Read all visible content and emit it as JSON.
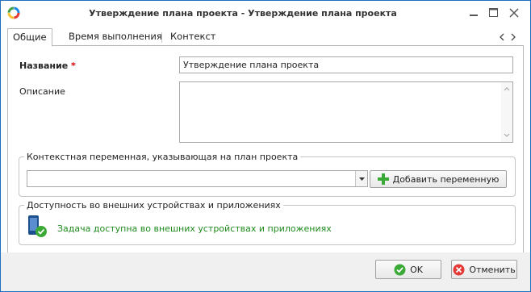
{
  "window": {
    "title": "Утверждение плана проекта - Утверждение плана проекта"
  },
  "tabs": [
    {
      "label": "Общие",
      "active": true
    },
    {
      "label": "Время выполнения",
      "active": false
    },
    {
      "label": "Контекст",
      "active": false
    }
  ],
  "form": {
    "name_label": "Название",
    "required_mark": "*",
    "name_value": "Утверждение плана проекта",
    "description_label": "Описание",
    "description_value": ""
  },
  "context_group": {
    "title": "Контекстная переменная, указывающая на план проекта",
    "select_value": "",
    "add_button_label": "Добавить переменную"
  },
  "availability_group": {
    "title": "Доступность во внешних устройствах и приложениях",
    "status_text": "Задача доступна во внешних устройствах и приложениях"
  },
  "footer": {
    "ok_label": "OK",
    "cancel_label": "Отменить"
  },
  "colors": {
    "window_border": "#1f6fbf",
    "required": "#d40000",
    "status_green": "#1f8a1f"
  }
}
